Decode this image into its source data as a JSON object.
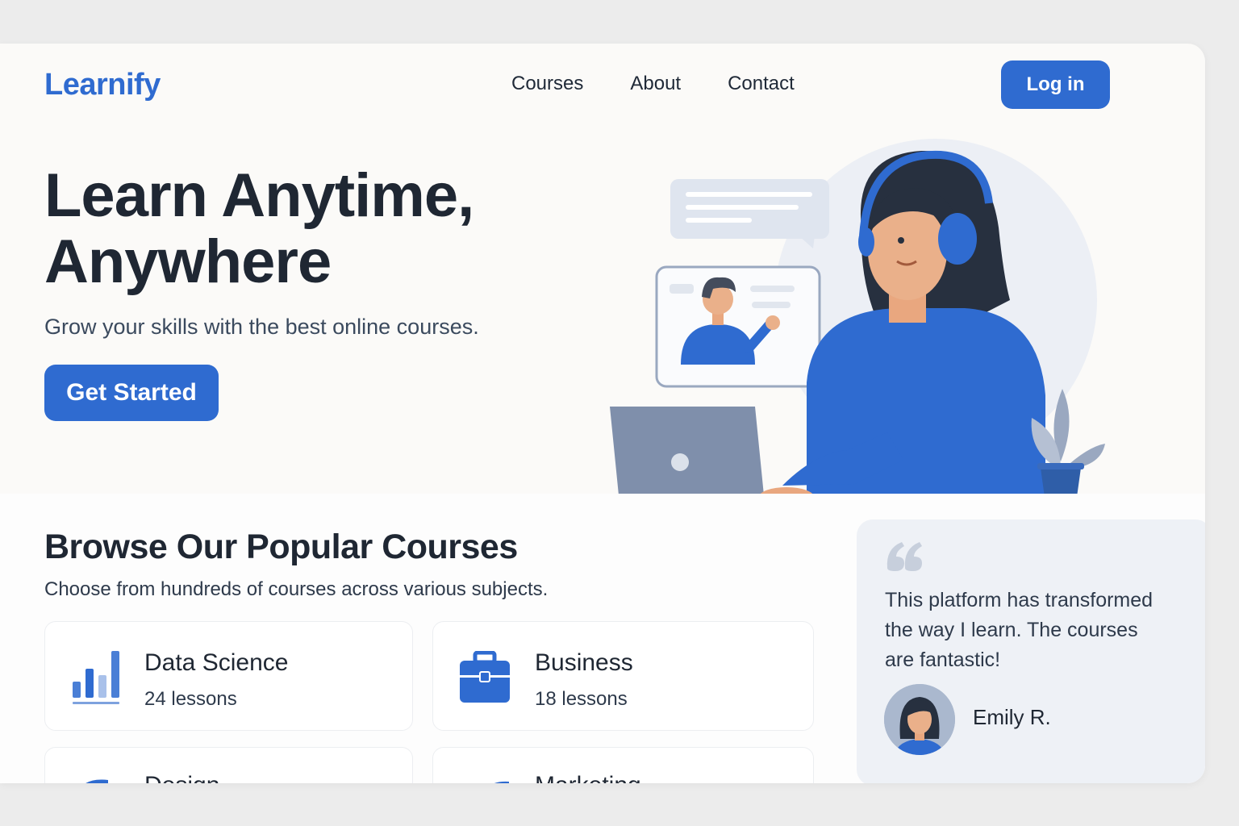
{
  "brand": {
    "logo": "Learnify"
  },
  "nav": {
    "items": [
      {
        "label": "Courses"
      },
      {
        "label": "About"
      },
      {
        "label": "Contact"
      }
    ],
    "login_label": "Log in"
  },
  "hero": {
    "title_line1": "Learn Anytime,",
    "title_line2": "Anywhere",
    "subtitle": "Grow your skills with the best online courses.",
    "cta_label": "Get Started"
  },
  "courses": {
    "title": "Browse Our Popular Courses",
    "subtitle": "Choose from hundreds of courses across various subjects.",
    "items": [
      {
        "name": "Data Science",
        "lessons": "24 lessons",
        "icon": "bar-chart-icon"
      },
      {
        "name": "Business",
        "lessons": "18 lessons",
        "icon": "briefcase-icon"
      },
      {
        "name": "Design",
        "lessons": "",
        "icon": "design-icon"
      },
      {
        "name": "Marketing",
        "lessons": "",
        "icon": "marketing-icon"
      }
    ]
  },
  "testimonial": {
    "quote": "This platform has transformed the way I learn. The courses are fantastic!",
    "author": "Emily R."
  },
  "colors": {
    "accent": "#2f6bd0",
    "text_dark": "#1f2733",
    "panel": "#eef1f6"
  }
}
